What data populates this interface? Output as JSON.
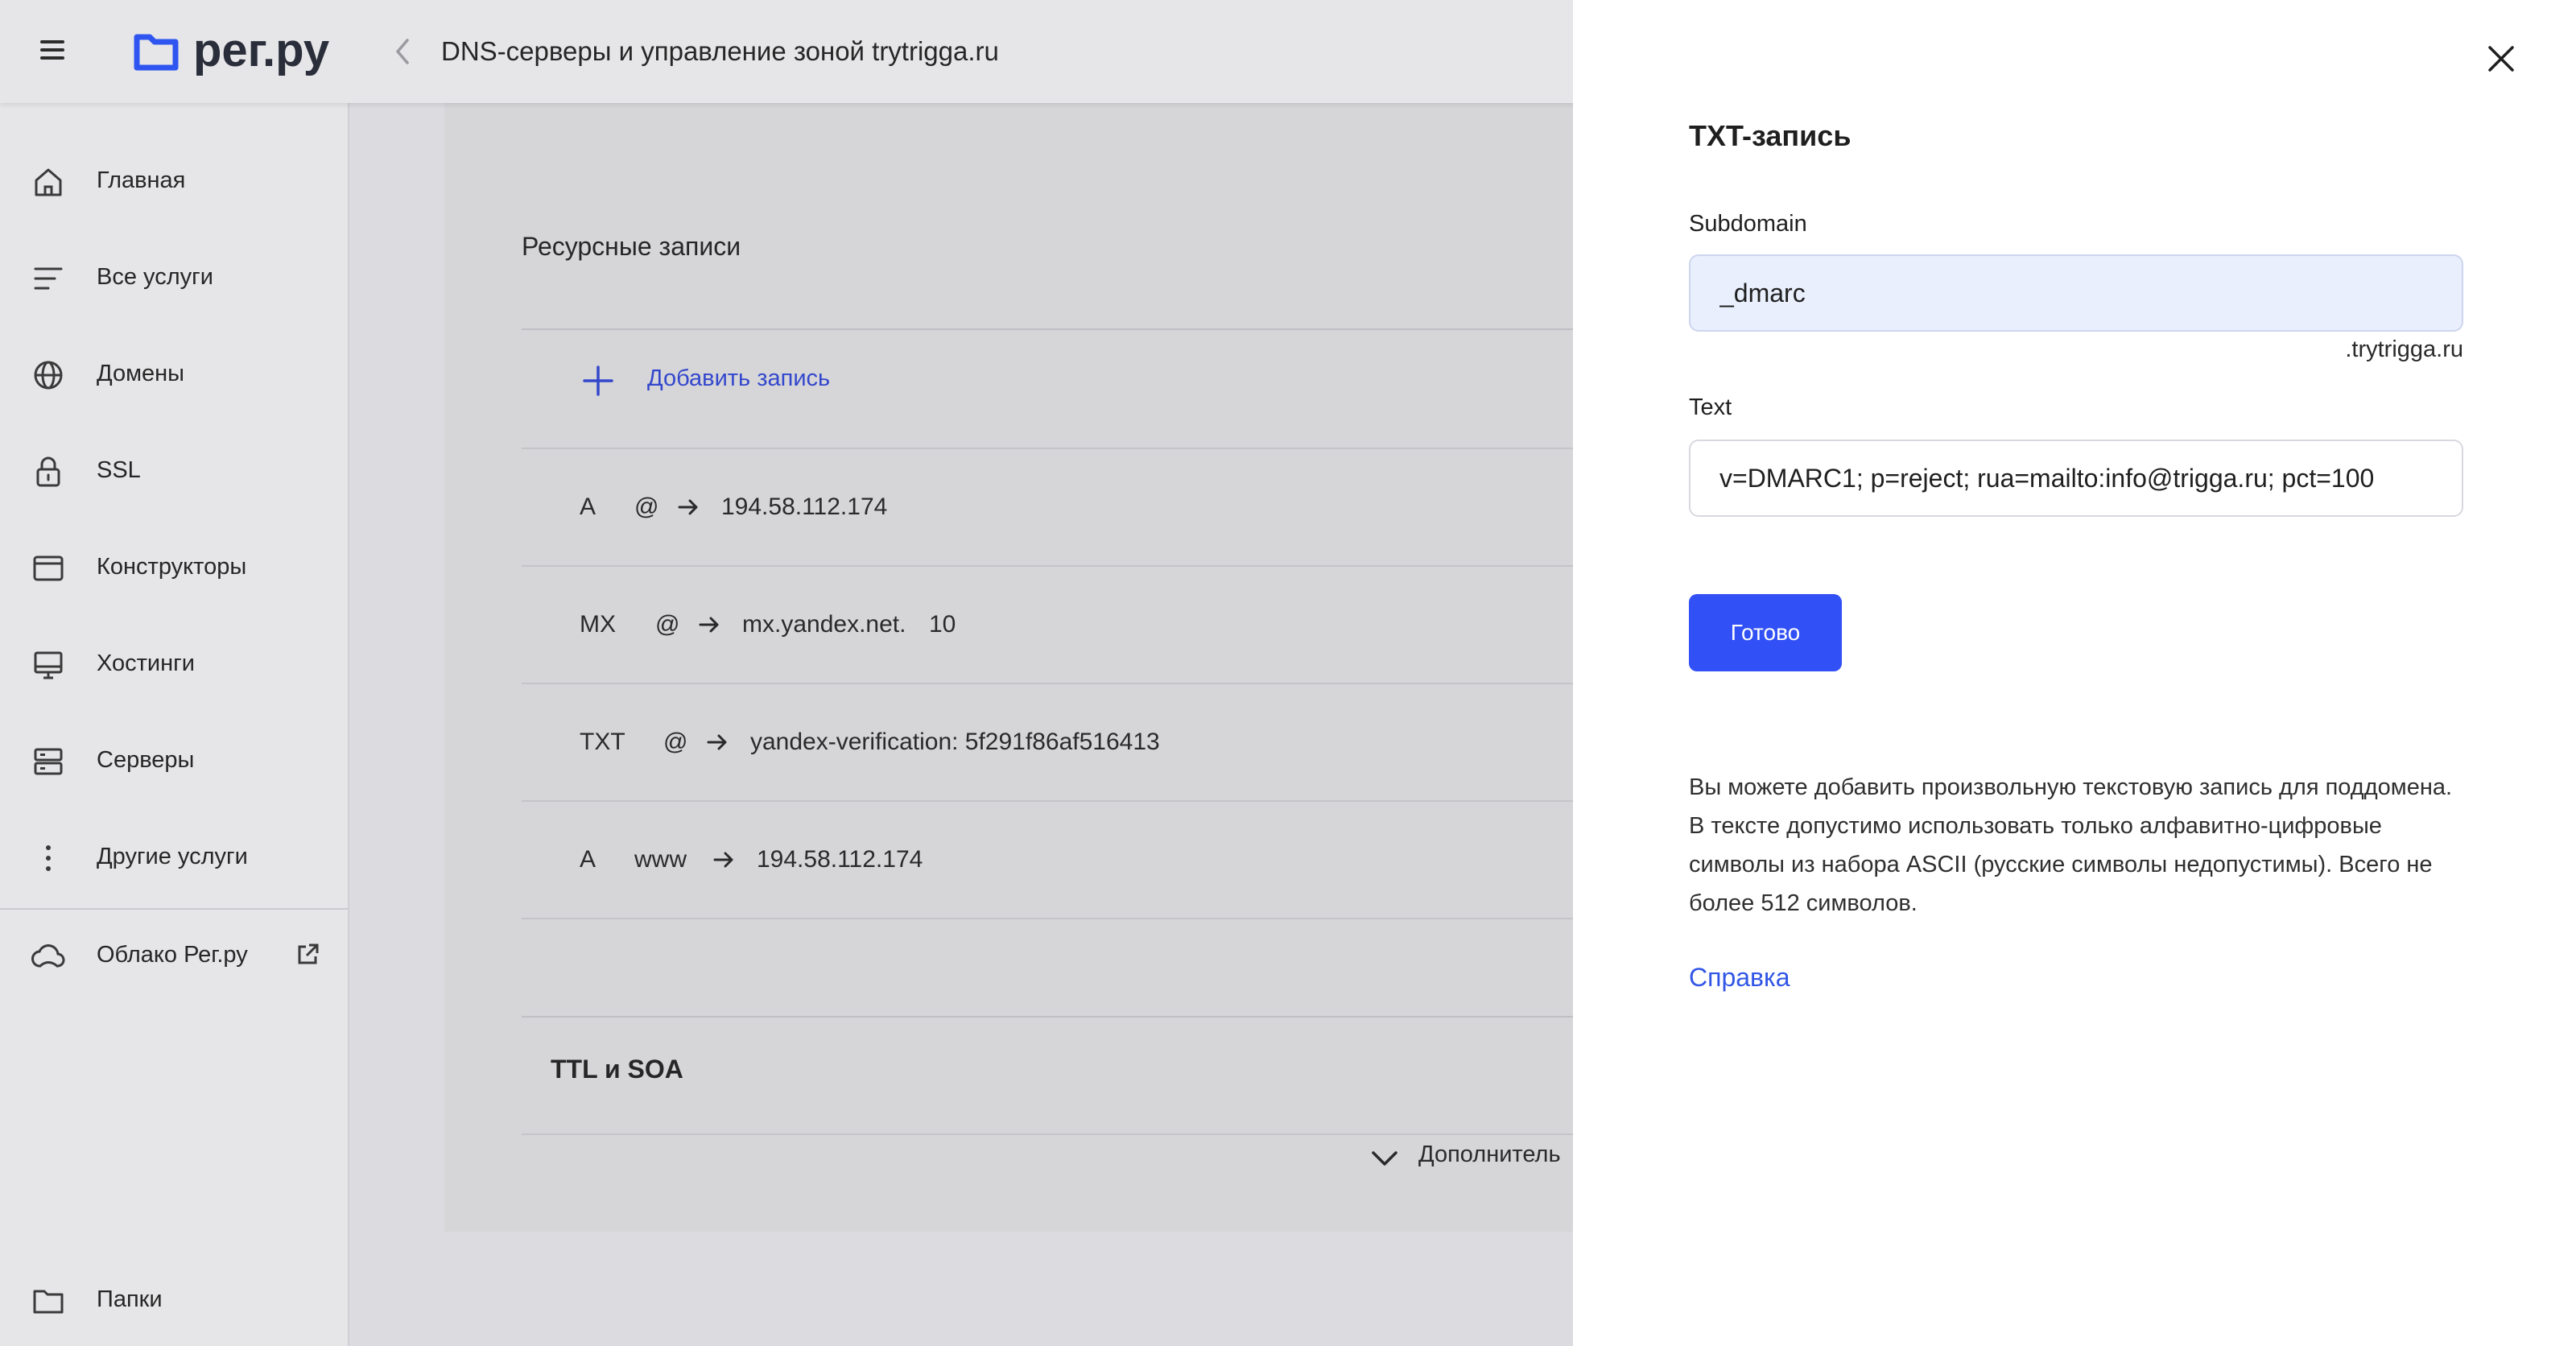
{
  "header": {
    "logo_text": "рег.ру",
    "page_title": "DNS-серверы и управление зоной trytrigga.ru"
  },
  "sidebar": {
    "items": [
      {
        "label": "Главная",
        "icon": "home-icon"
      },
      {
        "label": "Все услуги",
        "icon": "list-icon"
      },
      {
        "label": "Домены",
        "icon": "globe-icon"
      },
      {
        "label": "SSL",
        "icon": "lock-icon"
      },
      {
        "label": "Конструкторы",
        "icon": "browser-window-icon"
      },
      {
        "label": "Хостинги",
        "icon": "monitor-icon"
      },
      {
        "label": "Серверы",
        "icon": "server-icon"
      },
      {
        "label": "Другие услуги",
        "icon": "more-vertical-icon"
      }
    ],
    "cloud": {
      "label": "Облако Рег.ру",
      "icon": "cloud-icon",
      "external_icon": "external-link-icon"
    },
    "folders": {
      "label": "Папки",
      "icon": "folder-icon"
    }
  },
  "main": {
    "section_title": "Ресурсные записи",
    "add_record_label": "Добавить запись",
    "records": [
      {
        "type": "A",
        "host": "@",
        "value": "194.58.112.174",
        "priority": ""
      },
      {
        "type": "MX",
        "host": "@",
        "value": "mx.yandex.net.",
        "priority": "10"
      },
      {
        "type": "TXT",
        "host": "@",
        "value": "yandex-verification: 5f291f86af516413",
        "priority": ""
      },
      {
        "type": "A",
        "host": "www",
        "value": "194.58.112.174",
        "priority": ""
      }
    ],
    "ttl_title": "TTL и SOA",
    "more_label": "Дополнитель"
  },
  "panel": {
    "title": "TXT-запись",
    "subdomain_label": "Subdomain",
    "subdomain_value": "_dmarc",
    "domain_suffix": ".trytrigga.ru",
    "text_label": "Text",
    "text_value": "v=DMARC1; p=reject; rua=mailto:info@trigga.ru; pct=100",
    "done_label": "Готово",
    "help_text": "Вы можете добавить произвольную текстовую запись для поддомена. В тексте допустимо использовать только алфавитно-цифровые символы из набора ASCII (русские символы недопустимы). Всего не более 512 символов.",
    "help_link": "Справка"
  },
  "colors": {
    "accent_blue": "#3150f5",
    "link_blue": "#3156e6",
    "overlay_gray": "#d6d6d9"
  }
}
